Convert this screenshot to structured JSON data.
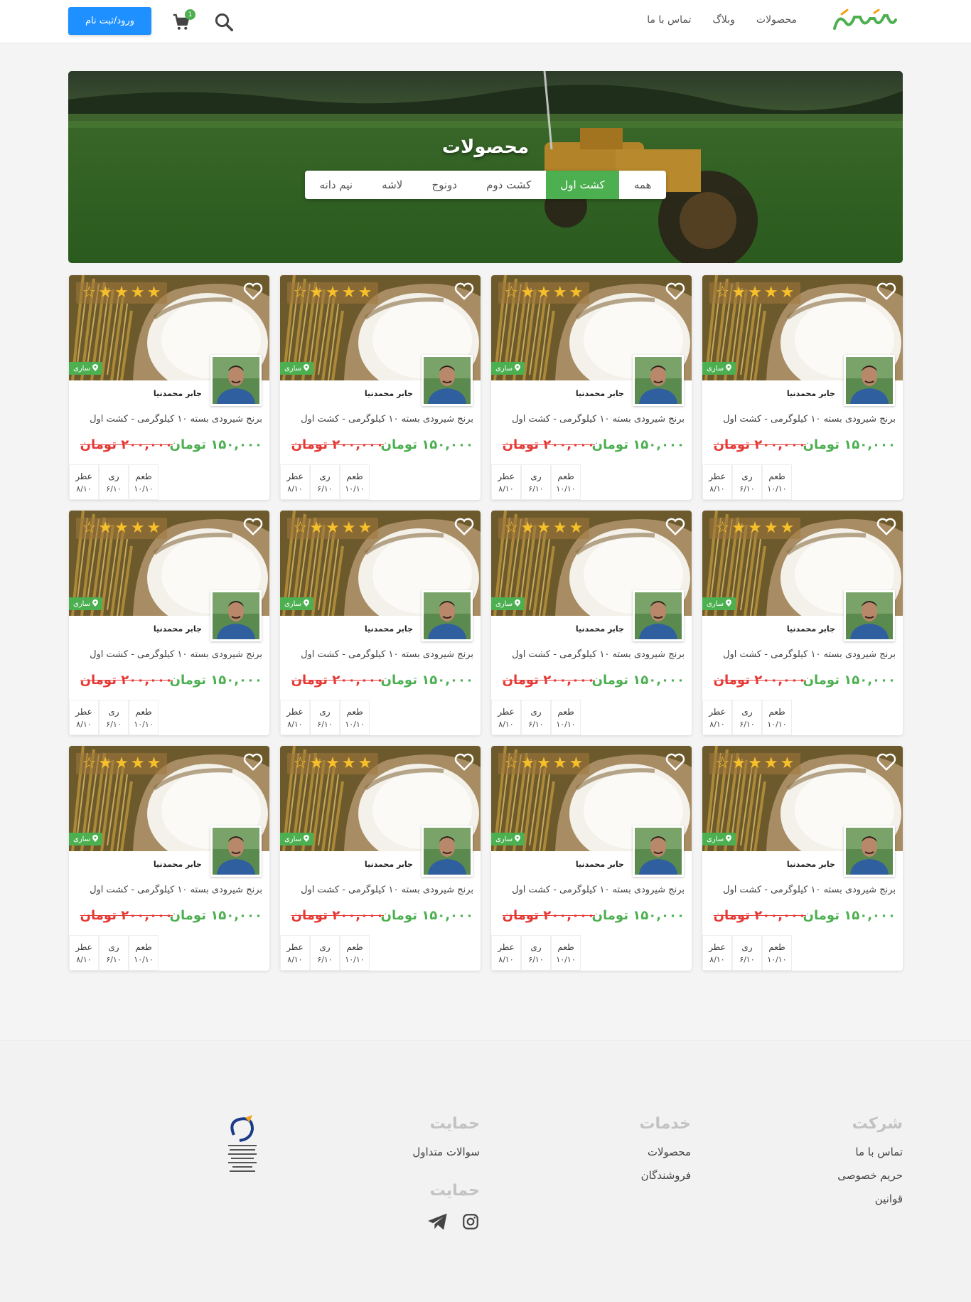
{
  "header": {
    "logo_text": "مزرعه‌نیادا",
    "nav": [
      "محصولات",
      "وبلاگ",
      "تماس با ما"
    ],
    "cart_count": "1",
    "login_label": "ورود/ثبت نام"
  },
  "hero": {
    "title": "محصولات",
    "tabs": [
      "همه",
      "کشت اول",
      "کشت دوم",
      "دونوج",
      "لاشه",
      "نیم دانه"
    ],
    "active_tab": "کشت اول"
  },
  "product": {
    "location": "ساری",
    "seller": "جابر محمدنیا",
    "name": "برنج شیرودی بسته ۱۰ کیلوگرمی - کشت اول",
    "price_new": "۱۵۰,۰۰۰ تومان",
    "price_old": "۲۰۰,۰۰۰ تومان",
    "rating": 4,
    "rating_max": 5,
    "attrs": [
      {
        "label": "طعم",
        "value": "۱۰/۱۰"
      },
      {
        "label": "ری",
        "value": "۶/۱۰"
      },
      {
        "label": "عطر",
        "value": "۸/۱۰"
      }
    ]
  },
  "footer": {
    "company": {
      "title": "شرکت",
      "links": [
        "تماس با ما",
        "حریم خصوصی",
        "قوانین"
      ]
    },
    "services": {
      "title": "خدمات",
      "links": [
        "محصولات",
        "فروشندگان"
      ]
    },
    "support": {
      "title": "حمایت",
      "links": [
        "سوالات متداول"
      ]
    },
    "social": {
      "title": "حمایت",
      "icons": [
        "instagram-icon",
        "telegram-icon"
      ]
    }
  },
  "colors": {
    "accent": "#4caf50",
    "primary": "#1e90ff",
    "danger": "#e53935"
  }
}
